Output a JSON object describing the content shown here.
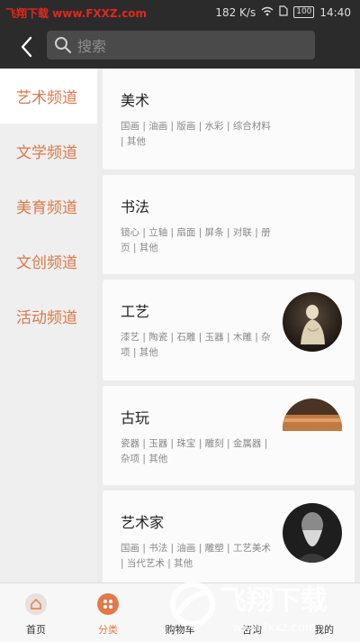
{
  "status_bar": {
    "watermark": "飞翔下载 www.FXXZ.com",
    "speed": "182 K/s",
    "battery": "100",
    "time": "14:40"
  },
  "header": {
    "search_placeholder": "搜索"
  },
  "sidebar": {
    "items": [
      {
        "label": "艺术频道",
        "active": true
      },
      {
        "label": "文学频道",
        "active": false
      },
      {
        "label": "美育频道",
        "active": false
      },
      {
        "label": "文创频道",
        "active": false
      },
      {
        "label": "活动频道",
        "active": false
      }
    ]
  },
  "cards": [
    {
      "title": "美术",
      "tags_line1": "国画 | 油画 | 版画 | 水彩 | 综合材料",
      "tags_line2": "| 其他"
    },
    {
      "title": "书法",
      "tags_line1": "镜心 | 立轴 | 扇面 | 屏条 | 对联 | 册",
      "tags_line2": "页 | 其他"
    },
    {
      "title": "工艺",
      "tags_line1": "漆艺 | 陶瓷 | 石雕 | 玉器 | 木雕 | 杂",
      "tags_line2": "项 | 其他"
    },
    {
      "title": "古玩",
      "tags_line1": "瓷器 | 玉器 | 珠宝 | 雕刻 | 金属器 |",
      "tags_line2": "杂项 | 其他"
    },
    {
      "title": "艺术家",
      "tags_line1": "国画 | 书法 | 油画 | 雕塑 | 工艺美术",
      "tags_line2": "| 当代艺术 | 其他"
    }
  ],
  "tabbar": {
    "items": [
      {
        "label": "首页",
        "icon": "home-icon",
        "active": false
      },
      {
        "label": "分类",
        "icon": "category-icon",
        "active": true
      },
      {
        "label": "购物车",
        "icon": "cart-icon",
        "active": false
      },
      {
        "label": "咨询",
        "icon": "consult-icon",
        "active": false
      },
      {
        "label": "我的",
        "icon": "profile-icon",
        "active": false
      }
    ]
  },
  "watermark_bottom": {
    "brand": "飞翔下载",
    "url": "www.fxxz.com"
  },
  "colors": {
    "accent": "#e07a4b",
    "topbar": "#2b2b2b",
    "watermark": "#e0281e"
  }
}
